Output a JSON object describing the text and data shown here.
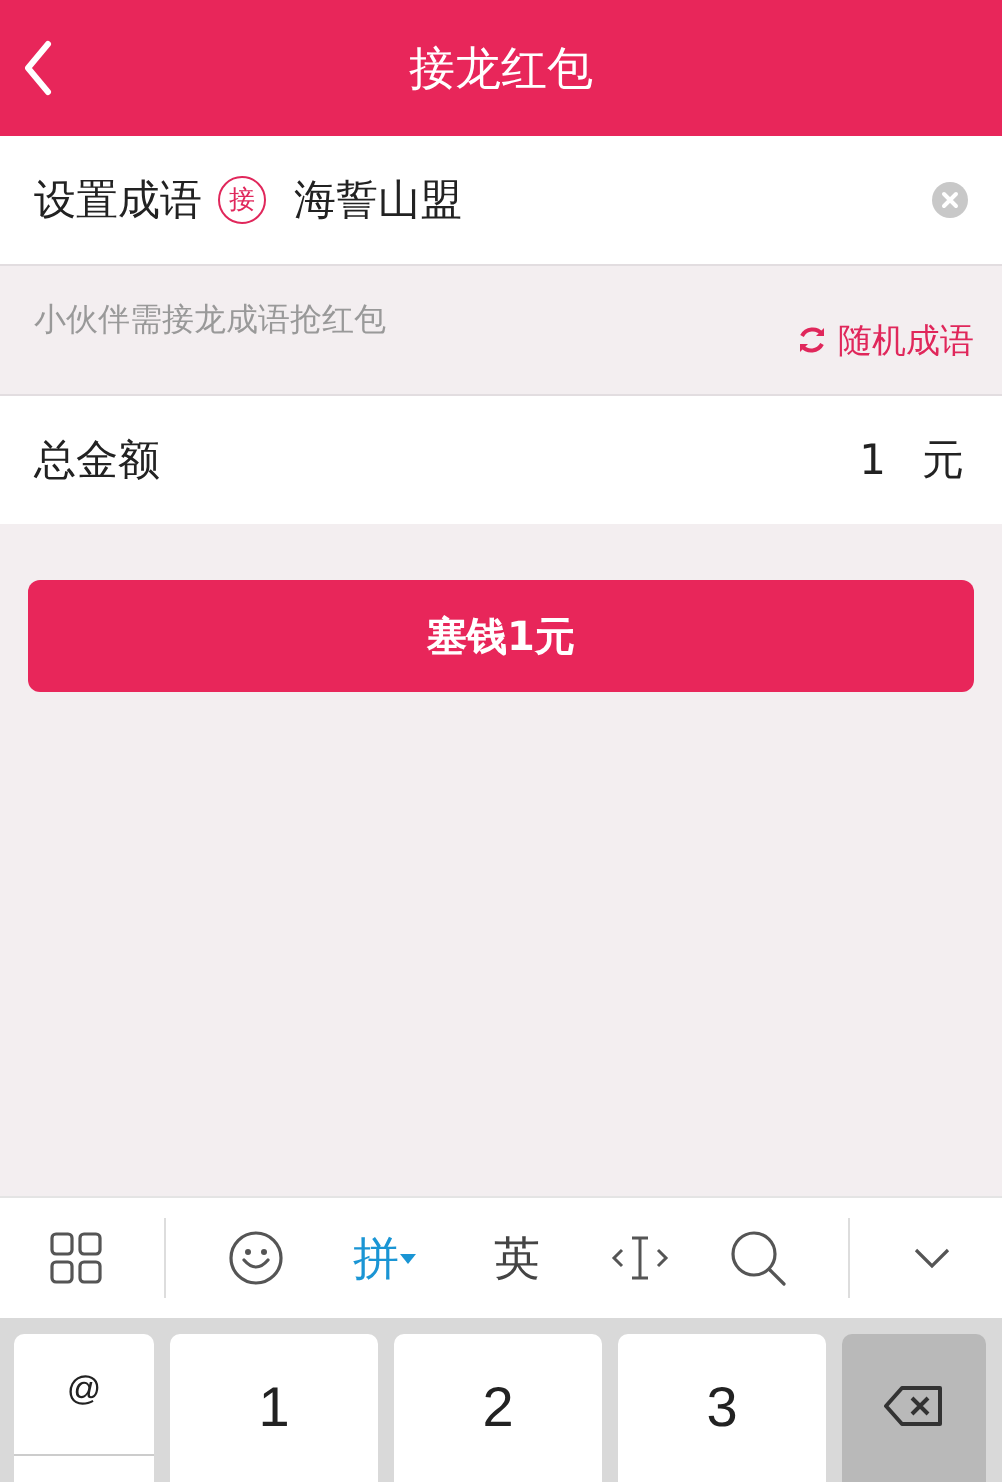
{
  "header": {
    "title": "接龙红包"
  },
  "idiom_row": {
    "label": "设置成语",
    "badge": "接",
    "value": "海誓山盟"
  },
  "hint_row": {
    "hint": "小伙伴需接龙成语抢红包",
    "random_link": "随机成语"
  },
  "amount_row": {
    "label": "总金额",
    "value": "1",
    "unit": "元"
  },
  "submit_button": "塞钱1元",
  "keyboard_toolbar": {
    "input_modes": [
      {
        "label": "拼",
        "selected": true
      },
      {
        "label": "英",
        "selected": false
      }
    ]
  },
  "keyboard": {
    "side_key": "@",
    "keys": [
      "1",
      "2",
      "3"
    ]
  }
}
